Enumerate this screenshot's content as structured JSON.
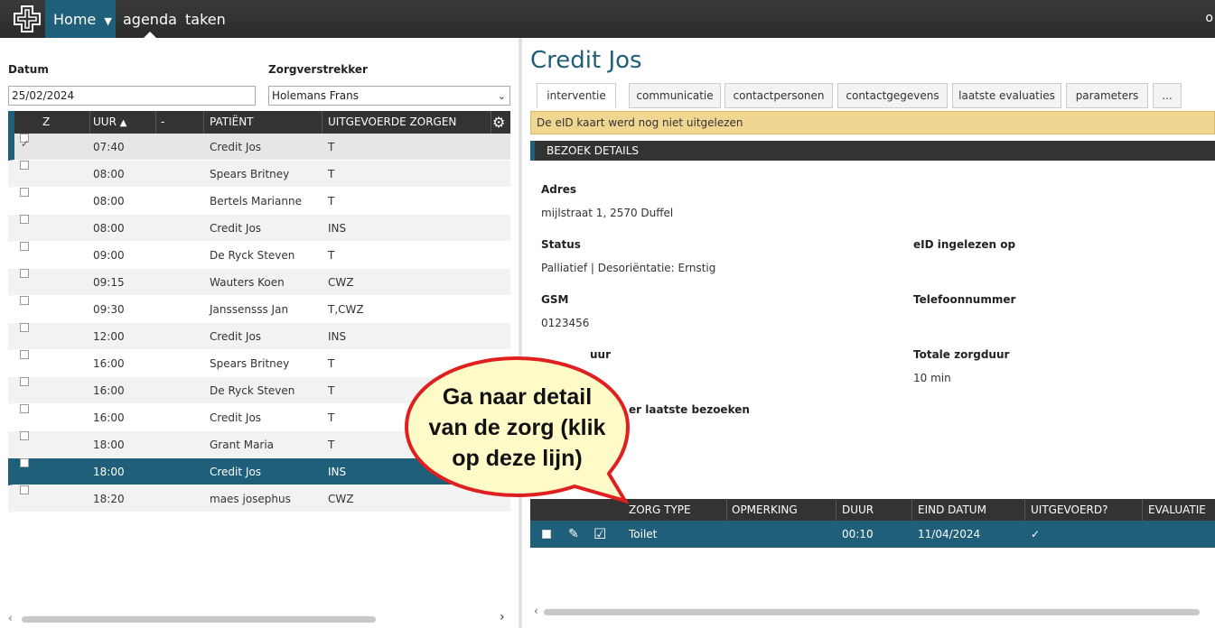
{
  "nav": {
    "home_label": "Home",
    "items": [
      "agenda",
      "taken"
    ],
    "right_text": "o"
  },
  "left": {
    "date_label": "Datum",
    "date_value": "25/02/2024",
    "provider_label": "Zorgverstrekker",
    "provider_value": "Holemans Frans",
    "columns": [
      "Z",
      "UUR",
      "-",
      "PATIËNT",
      "UITGEVOERDE ZORGEN"
    ],
    "rows": [
      {
        "checked": true,
        "time": "07:40",
        "patient": "Credit Jos",
        "care": "T"
      },
      {
        "checked": false,
        "time": "08:00",
        "patient": "Spears Britney",
        "care": "T"
      },
      {
        "checked": false,
        "time": "08:00",
        "patient": "Bertels Marianne",
        "care": "T"
      },
      {
        "checked": false,
        "time": "08:00",
        "patient": "Credit Jos",
        "care": "INS"
      },
      {
        "checked": false,
        "time": "09:00",
        "patient": "De Ryck Steven",
        "care": "T"
      },
      {
        "checked": false,
        "time": "09:15",
        "patient": "Wauters Koen",
        "care": "CWZ"
      },
      {
        "checked": false,
        "time": "09:30",
        "patient": "Janssensss Jan",
        "care": "T,CWZ"
      },
      {
        "checked": false,
        "time": "12:00",
        "patient": "Credit Jos",
        "care": "INS"
      },
      {
        "checked": false,
        "time": "16:00",
        "patient": "Spears Britney",
        "care": "T"
      },
      {
        "checked": false,
        "time": "16:00",
        "patient": "De Ryck Steven",
        "care": "T"
      },
      {
        "checked": false,
        "time": "16:00",
        "patient": "Credit Jos",
        "care": "T"
      },
      {
        "checked": false,
        "time": "18:00",
        "patient": "Grant Maria",
        "care": "T"
      },
      {
        "checked": false,
        "time": "18:00",
        "patient": "Credit Jos",
        "care": "INS"
      },
      {
        "checked": false,
        "time": "18:20",
        "patient": "maes josephus",
        "care": "CWZ"
      }
    ],
    "selected_row": 12
  },
  "right": {
    "title": "Credit Jos",
    "tabs": [
      "interventie",
      "communicatie",
      "contactpersonen",
      "contactgegevens",
      "laatste evaluaties",
      "parameters",
      "..."
    ],
    "active_tab": 0,
    "warning": "De eID kaart werd nog niet uitgelezen",
    "section_title": "BEZOEK DETAILS",
    "fields": {
      "adres_label": "Adres",
      "adres_value": "mijlstraat 1, 2570 Duffel",
      "status_label": "Status",
      "status_value": "Palliatief | Desoriëntatie: Ernstig",
      "eid_label": "eID ingelezen op",
      "gsm_label": "GSM",
      "gsm_value": "0123456",
      "tel_label": "Telefoonnummer",
      "duur_label_partial": "uur",
      "totale_label": "Totale zorgduur",
      "totale_value": "10 min",
      "bezoeken_label_partial": "er laatste bezoeken"
    },
    "care_table": {
      "columns": [
        "ZORG TYPE",
        "OPMERKING",
        "DUUR",
        "EIND DATUM",
        "UITGEVOERD?",
        "EVALUATIE"
      ],
      "row": {
        "type": "Toilet",
        "remark": "",
        "duration": "00:10",
        "end_date": "11/04/2024",
        "done": "✓",
        "evaluation": ""
      }
    }
  },
  "callout": {
    "text_lines": [
      "Ga naar detail",
      "van de zorg (klik",
      "op deze lijn)"
    ]
  },
  "colors": {
    "accent": "#1f5f7a",
    "header_dark": "#333333",
    "warning_bg": "#f1d692",
    "callout_fill": "#fffbc8",
    "callout_stroke": "#e02020"
  }
}
